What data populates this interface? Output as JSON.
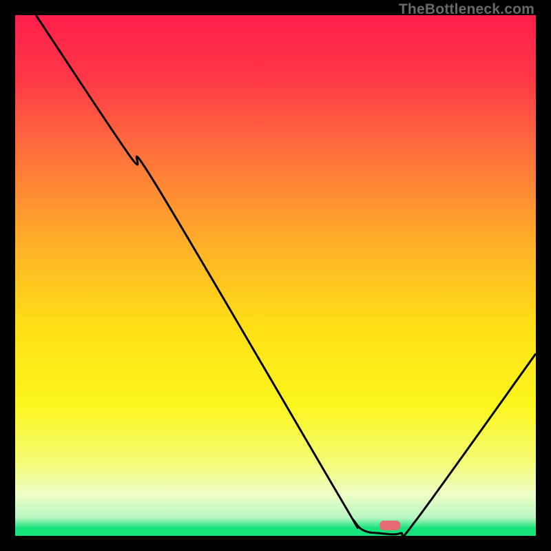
{
  "watermark": "TheBottleneck.com",
  "chart_data": {
    "type": "line",
    "title": "",
    "xlabel": "",
    "ylabel": "",
    "xlim": [
      0,
      100
    ],
    "ylim": [
      0,
      100
    ],
    "grid": false,
    "legend": false,
    "background_gradient": {
      "stops": [
        {
          "pos": 0.0,
          "color": "#ff1f4b"
        },
        {
          "pos": 0.12,
          "color": "#ff3747"
        },
        {
          "pos": 0.25,
          "color": "#ff6b3e"
        },
        {
          "pos": 0.45,
          "color": "#ffb327"
        },
        {
          "pos": 0.6,
          "color": "#ffe016"
        },
        {
          "pos": 0.75,
          "color": "#fbf61e"
        },
        {
          "pos": 0.86,
          "color": "#f4fb77"
        },
        {
          "pos": 0.92,
          "color": "#eefec7"
        },
        {
          "pos": 0.965,
          "color": "#b9f7c4"
        },
        {
          "pos": 0.985,
          "color": "#18e47c"
        },
        {
          "pos": 1.0,
          "color": "#18e47c"
        }
      ]
    },
    "series": [
      {
        "name": "bottleneck-curve",
        "color": "#000000",
        "points": [
          {
            "x": 4,
            "y": 100
          },
          {
            "x": 22,
            "y": 73
          },
          {
            "x": 27,
            "y": 67.5
          },
          {
            "x": 62,
            "y": 8
          },
          {
            "x": 65,
            "y": 3
          },
          {
            "x": 67,
            "y": 1
          },
          {
            "x": 70,
            "y": 0.5
          },
          {
            "x": 74,
            "y": 0.5
          },
          {
            "x": 77,
            "y": 3
          },
          {
            "x": 100,
            "y": 35
          }
        ]
      }
    ],
    "markers": [
      {
        "name": "optimal-marker",
        "shape": "rounded-rect",
        "x": 72,
        "y": 2,
        "color": "#e56a72"
      }
    ]
  }
}
